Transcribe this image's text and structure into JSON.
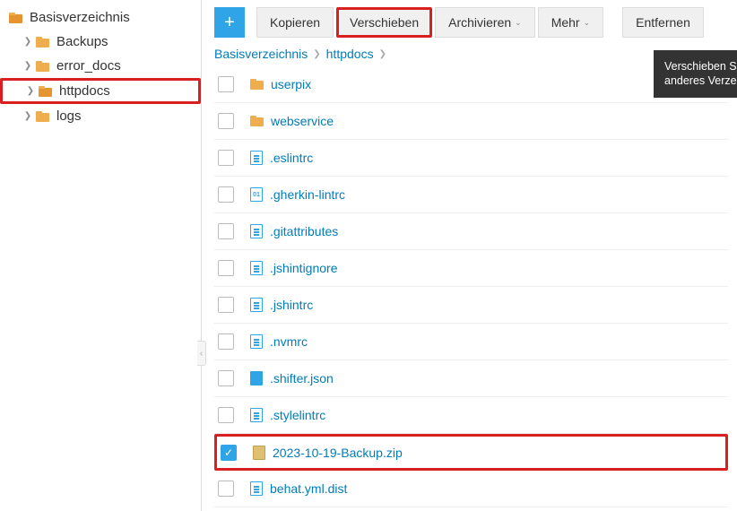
{
  "sidebar": {
    "root_label": "Basisverzeichnis",
    "items": [
      {
        "label": "Backups"
      },
      {
        "label": "error_docs"
      },
      {
        "label": "httpdocs"
      },
      {
        "label": "logs"
      }
    ]
  },
  "toolbar": {
    "copy": "Kopieren",
    "move": "Verschieben",
    "archive": "Archivieren",
    "more": "Mehr",
    "remove": "Entfernen"
  },
  "tooltip": "Verschieben Sie ausgewählte Dateien in ein anderes Verzeichnis.",
  "breadcrumb": {
    "root": "Basisverzeichnis",
    "current": "httpdocs"
  },
  "files": [
    {
      "name": "userpix",
      "type": "folder"
    },
    {
      "name": "webservice",
      "type": "folder"
    },
    {
      "name": ".eslintrc",
      "type": "file"
    },
    {
      "name": ".gherkin-lintrc",
      "type": "num",
      "badge": "01"
    },
    {
      "name": ".gitattributes",
      "type": "file"
    },
    {
      "name": ".jshintignore",
      "type": "file"
    },
    {
      "name": ".jshintrc",
      "type": "file"
    },
    {
      "name": ".nvmrc",
      "type": "file"
    },
    {
      "name": ".shifter.json",
      "type": "json"
    },
    {
      "name": ".stylelintrc",
      "type": "file"
    },
    {
      "name": "2023-10-19-Backup.zip",
      "type": "zip",
      "checked": true,
      "highlight": true
    },
    {
      "name": "behat.yml.dist",
      "type": "file"
    }
  ]
}
